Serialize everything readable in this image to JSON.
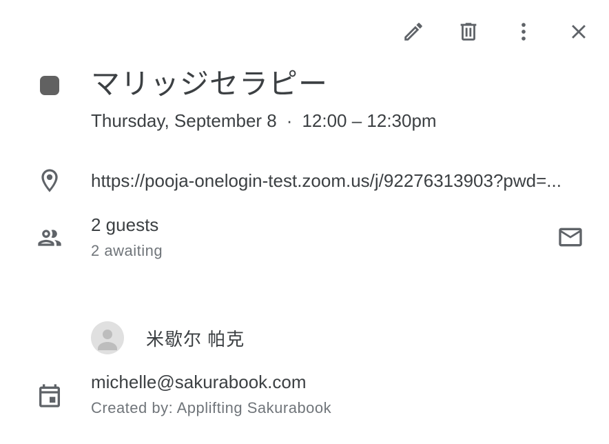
{
  "event": {
    "title": "マリッジセラピー",
    "date": "Thursday, September 8",
    "separator": "·",
    "time": "12:00 – 12:30pm",
    "color": "#616161"
  },
  "toolbar": {
    "edit_icon": "pencil-icon",
    "delete_icon": "trash-icon",
    "more_icon": "more-vert-icon",
    "close_icon": "close-icon"
  },
  "location": {
    "icon": "location-pin-icon",
    "text": "https://pooja-onelogin-test.zoom.us/j/92276313903?pwd=..."
  },
  "guests": {
    "icon": "people-icon",
    "count_label": "2 guests",
    "status_label": "2 awaiting",
    "email_icon": "mail-icon",
    "list": [
      {
        "name": "米歇尔 帕克"
      }
    ]
  },
  "organizer": {
    "icon": "calendar-icon",
    "email": "michelle@sakurabook.com",
    "created_by": "Created by: Applifting Sakurabook"
  }
}
